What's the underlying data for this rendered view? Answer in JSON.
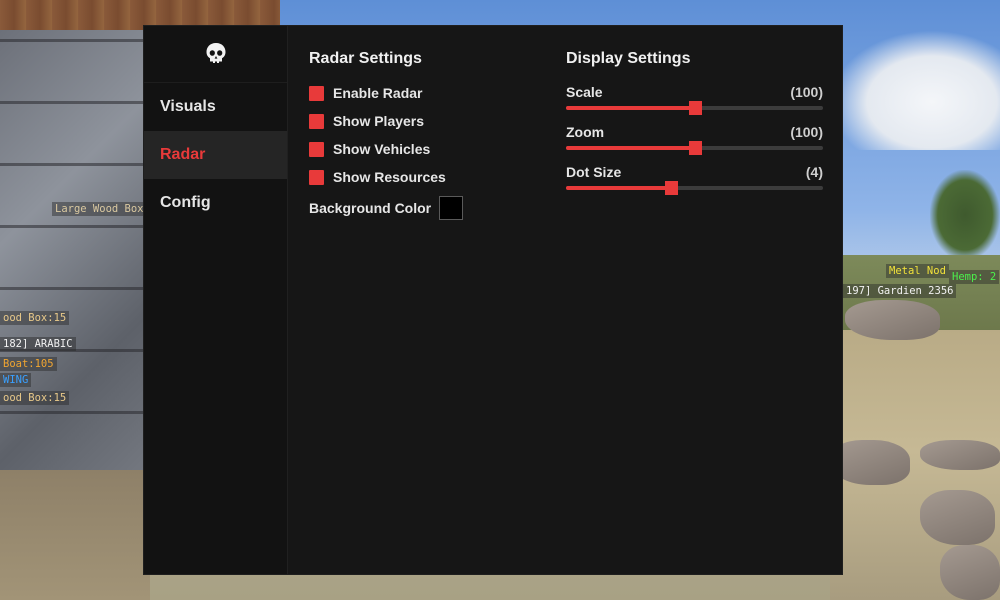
{
  "menu": {
    "nav": [
      {
        "label": "Visuals",
        "active": false
      },
      {
        "label": "Radar",
        "active": true
      },
      {
        "label": "Config",
        "active": false
      }
    ],
    "radar_settings": {
      "title": "Radar Settings",
      "options": [
        {
          "label": "Enable Radar",
          "checked": true
        },
        {
          "label": "Show Players",
          "checked": true
        },
        {
          "label": "Show Vehicles",
          "checked": true
        },
        {
          "label": "Show Resources",
          "checked": true
        }
      ],
      "background_color": {
        "label": "Background Color",
        "value": "#000000"
      }
    },
    "display_settings": {
      "title": "Display Settings",
      "sliders": [
        {
          "label": "Scale",
          "value_text": "(100)",
          "fraction": 0.5
        },
        {
          "label": "Zoom",
          "value_text": "(100)",
          "fraction": 0.5
        },
        {
          "label": "Dot Size",
          "value_text": "(4)",
          "fraction": 0.41
        }
      ]
    },
    "accent_color": "#e83a3a"
  },
  "esp_labels": [
    {
      "text": "Large Wood Box",
      "color": "#d9c8a0"
    },
    {
      "text": "ood Box:15",
      "color": "#e8c98a"
    },
    {
      "text": "182] ARABIC",
      "color": "#f2f2f2"
    },
    {
      "text": "Boat:105",
      "color": "#f0a531"
    },
    {
      "text": "WING",
      "color": "#3aa0ff"
    },
    {
      "text": "ood Box:15",
      "color": "#e8c98a"
    },
    {
      "text": "Metal Nod",
      "color": "#f2e23a"
    },
    {
      "text": "Hemp: 2",
      "color": "#4cf04c"
    },
    {
      "text": "197] Gardien 2356",
      "color": "#f2f2f2"
    }
  ]
}
